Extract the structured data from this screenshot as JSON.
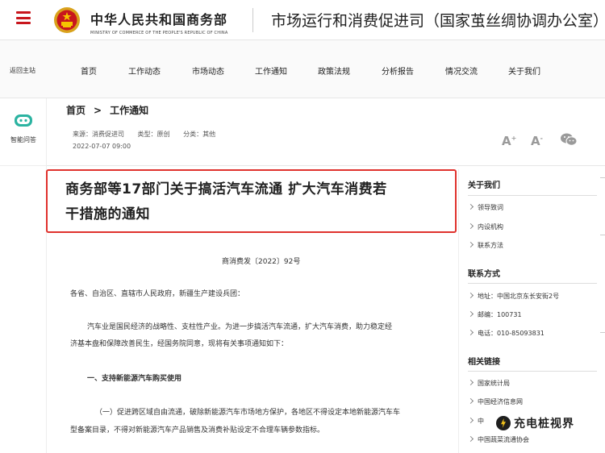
{
  "header": {
    "brand_cn": "中华人民共和国商务部",
    "brand_en": "MINISTRY OF COMMERCE OF THE PEOPLE'S REPUBLIC OF CHINA",
    "site_title": "市场运行和消费促进司（国家茧丝绸协调办公室）",
    "accent_color": "#c8161d"
  },
  "nav": {
    "back_label": "返回主站",
    "items": [
      "首页",
      "工作动态",
      "市场动态",
      "工作通知",
      "政策法规",
      "分析报告",
      "情况交流",
      "关于我们"
    ]
  },
  "left_rail": {
    "assistant_label": "智能问答"
  },
  "breadcrumb": {
    "home": "首页",
    "separator": ">",
    "current": "工作通知"
  },
  "meta": {
    "source": "来源：消费促进司",
    "type": "类型：原创",
    "category": "分类：其他",
    "date": "2022-07-07 09:00",
    "font_large": "A",
    "font_small": "A",
    "font_large_sup": "+",
    "font_small_sup": "-"
  },
  "article": {
    "title_line1": "商务部等17部门关于搞活汽车流通 扩大汽车消费若",
    "title_line2": "干措施的通知",
    "doc_number": "商消费发〔2022〕92号",
    "recipients": "各省、自治区、直辖市人民政府，新疆生产建设兵团：",
    "intro_line1": "汽车业是国民经济的战略性、支柱性产业。为进一步搞活汽车流通，扩大汽车消费，助力稳定经",
    "intro_line2": "济基本盘和保障改善民生，经国务院同意，现将有关事项通知如下：",
    "section1": "一、支持新能源汽车购买使用",
    "point1_line1": "（一）促进跨区域自由流通，破除新能源汽车市场地方保护，各地区不得设定本地新能源汽车车",
    "point1_line2": "型备案目录，不得对新能源汽车产品销售及消费补贴设定不合理车辆参数指标。"
  },
  "sidebar": {
    "about_title": "关于我们",
    "about_items": [
      "领导致词",
      "内设机构",
      "联系方法"
    ],
    "contact_title": "联系方式",
    "contact_items": [
      "地址：中国北京东长安街2号",
      "邮编：100731",
      "电话：010-85093831"
    ],
    "links_title": "相关链接",
    "links_items": [
      "国家统计局",
      "中国经济信息网",
      "中",
      "中国蔬菜流通协会"
    ]
  },
  "watermark": {
    "text": "充电桩视界"
  }
}
